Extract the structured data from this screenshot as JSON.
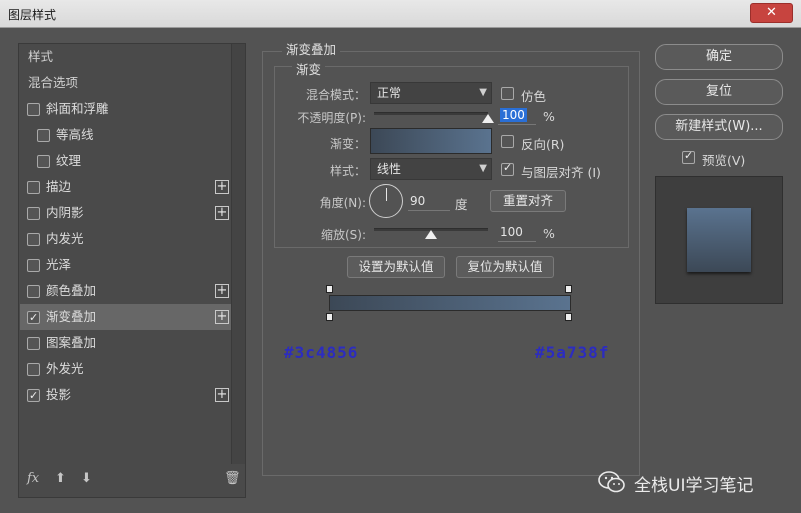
{
  "window": {
    "title": "图层样式",
    "close_label": "✕"
  },
  "styles_list": {
    "items": [
      {
        "label": "样式",
        "type": "header"
      },
      {
        "label": "混合选项",
        "type": "header"
      },
      {
        "label": "斜面和浮雕",
        "checked": false,
        "indent": 0,
        "plus": false
      },
      {
        "label": "等高线",
        "checked": false,
        "indent": 1,
        "plus": false
      },
      {
        "label": "纹理",
        "checked": false,
        "indent": 1,
        "plus": false
      },
      {
        "label": "描边",
        "checked": false,
        "indent": 0,
        "plus": true
      },
      {
        "label": "内阴影",
        "checked": false,
        "indent": 0,
        "plus": true
      },
      {
        "label": "内发光",
        "checked": false,
        "indent": 0,
        "plus": false
      },
      {
        "label": "光泽",
        "checked": false,
        "indent": 0,
        "plus": false
      },
      {
        "label": "颜色叠加",
        "checked": false,
        "indent": 0,
        "plus": true
      },
      {
        "label": "渐变叠加",
        "checked": true,
        "indent": 0,
        "plus": true,
        "selected": true
      },
      {
        "label": "图案叠加",
        "checked": false,
        "indent": 0,
        "plus": false
      },
      {
        "label": "外发光",
        "checked": false,
        "indent": 0,
        "plus": false
      },
      {
        "label": "投影",
        "checked": true,
        "indent": 0,
        "plus": true
      }
    ],
    "footer": {
      "fx_label": "fx",
      "up_icon": "arrow-up-icon",
      "down_icon": "arrow-down-icon",
      "trash_icon": "trash-icon"
    }
  },
  "gradient_overlay": {
    "group_title": "渐变叠加",
    "subgroup_title": "渐变",
    "blend_mode_label": "混合模式：",
    "blend_mode_value": "正常",
    "dither_label": "仿色",
    "dither_checked": false,
    "opacity_label": "不透明度(P):",
    "opacity_value": "100",
    "opacity_unit": "%",
    "opacity_level": 1.0,
    "gradient_label": "渐变：",
    "reverse_label": "反向(R)",
    "reverse_checked": false,
    "style_label": "样式：",
    "style_value": "线性",
    "align_label": "与图层对齐 (I)",
    "align_checked": true,
    "angle_label": "角度(N):",
    "angle_value": "90",
    "angle_unit": "度",
    "reset_align_label": "重置对齐",
    "scale_label": "缩放(S):",
    "scale_value": "100",
    "scale_unit": "%",
    "scale_level": 0.5,
    "set_default_label": "设置为默认值",
    "reset_default_label": "复位为默认值",
    "start_color": "#3c4856",
    "end_color": "#5a738f",
    "start_color_text": "#3c4856",
    "end_color_text": "#5a738f"
  },
  "right_panel": {
    "ok_label": "确定",
    "reset_label": "复位",
    "new_style_label": "新建样式(W)...",
    "preview_label": "预览(V)",
    "preview_checked": true
  },
  "watermark": {
    "text": "全栈UI学习笔记"
  }
}
